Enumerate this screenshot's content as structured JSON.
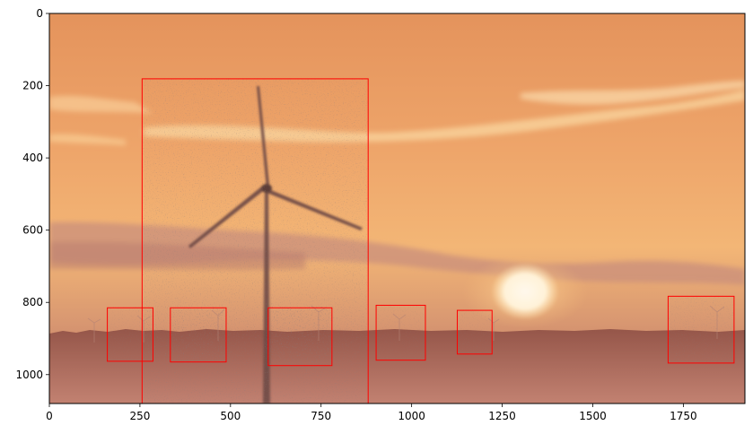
{
  "figure": {
    "x_ticks": [
      "0",
      "250",
      "500",
      "750",
      "1000",
      "1250",
      "1500",
      "1750"
    ],
    "y_ticks": [
      "0",
      "200",
      "400",
      "600",
      "800",
      "1000"
    ]
  },
  "image_extent": {
    "width": 1920,
    "height": 1080
  },
  "x_tick_values": [
    0,
    250,
    500,
    750,
    1000,
    1250,
    1500,
    1750
  ],
  "y_tick_values": [
    0,
    200,
    400,
    600,
    800,
    1000
  ],
  "colors": {
    "box": "#ff0000",
    "sky_top": "#e79a5f",
    "sky_mid": "#f6bd79",
    "ground": "#7a3e34"
  },
  "detections": [
    {
      "label": "wind-turbine",
      "x0": 256,
      "y0": 181,
      "x1": 880,
      "y1": 1080
    },
    {
      "label": "wind-turbine",
      "x0": 160,
      "y0": 815,
      "x1": 286,
      "y1": 963
    },
    {
      "label": "wind-turbine",
      "x0": 334,
      "y0": 815,
      "x1": 488,
      "y1": 965
    },
    {
      "label": "wind-turbine",
      "x0": 604,
      "y0": 815,
      "x1": 780,
      "y1": 975
    },
    {
      "label": "wind-turbine",
      "x0": 902,
      "y0": 808,
      "x1": 1038,
      "y1": 960
    },
    {
      "label": "wind-turbine",
      "x0": 1126,
      "y0": 822,
      "x1": 1222,
      "y1": 943
    },
    {
      "label": "wind-turbine",
      "x0": 1708,
      "y0": 783,
      "x1": 1890,
      "y1": 968
    }
  ]
}
